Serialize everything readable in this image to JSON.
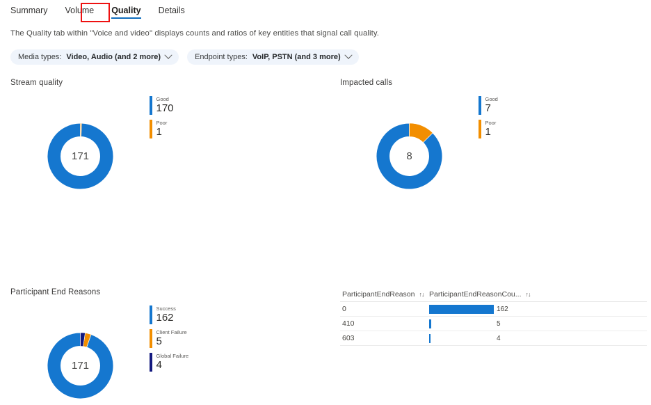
{
  "tabs": [
    {
      "label": "Summary",
      "active": false
    },
    {
      "label": "Volume",
      "active": false
    },
    {
      "label": "Quality",
      "active": true
    },
    {
      "label": "Details",
      "active": false
    }
  ],
  "description": "The Quality tab within \"Voice and video\" displays counts and ratios of key entities that signal call quality.",
  "filters": [
    {
      "prefix": "Media types:",
      "value": "Video, Audio (and 2 more)"
    },
    {
      "prefix": "Endpoint types:",
      "value": "VoIP, PSTN (and 3 more)"
    }
  ],
  "colors": {
    "primary_blue": "#1577cf",
    "orange": "#f28e00",
    "navy": "#13197f",
    "tab_accent": "#0f6cbd",
    "highlight_red": "#ee1111",
    "pill_bg": "#eff4fb"
  },
  "chart_data": [
    {
      "type": "pie",
      "title": "Stream quality",
      "center_total": "171",
      "categories": [
        "Good",
        "Poor"
      ],
      "values": [
        170,
        1
      ],
      "colors": [
        "#1577cf",
        "#f28e00"
      ],
      "legend_position": "right"
    },
    {
      "type": "pie",
      "title": "Impacted calls",
      "center_total": "8",
      "categories": [
        "Good",
        "Poor"
      ],
      "values": [
        7,
        1
      ],
      "colors": [
        "#1577cf",
        "#f28e00"
      ],
      "legend_position": "right"
    },
    {
      "type": "pie",
      "title": "Participant End Reasons",
      "center_total": "171",
      "categories": [
        "Success",
        "Client Failure",
        "Global Failure"
      ],
      "values": [
        162,
        5,
        4
      ],
      "colors": [
        "#1577cf",
        "#f28e00",
        "#13197f"
      ],
      "legend_position": "right"
    },
    {
      "type": "table",
      "columns": [
        "ParticipantEndReason",
        "ParticipantEndReasonCou..."
      ],
      "rows": [
        {
          "reason": "0",
          "count": 162
        },
        {
          "reason": "410",
          "count": 5
        },
        {
          "reason": "603",
          "count": 4
        }
      ],
      "bar_max": 162,
      "bar_color": "#1577cf"
    }
  ],
  "table": {
    "sort_icon": "↑↓"
  }
}
